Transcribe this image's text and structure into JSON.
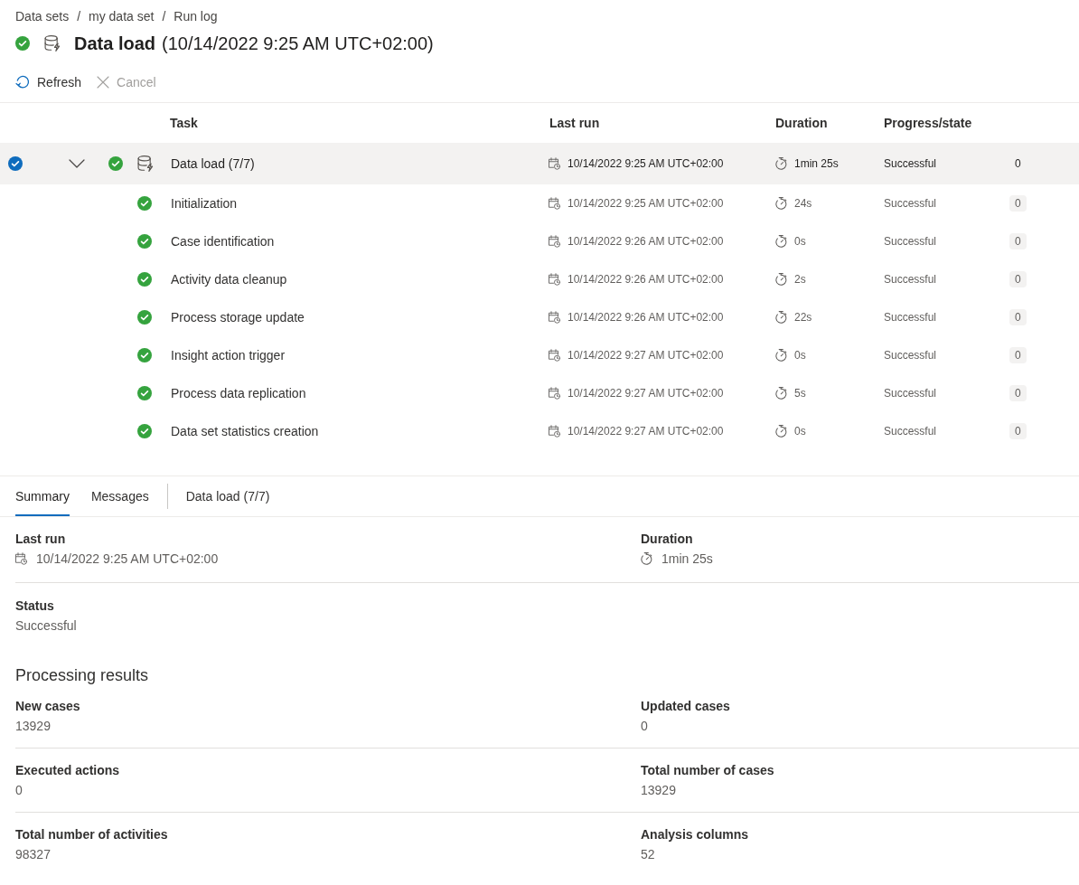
{
  "breadcrumb": [
    {
      "label": "Data sets",
      "separator": "/"
    },
    {
      "label": "my data set",
      "separator": "/"
    },
    {
      "label": "Run log"
    }
  ],
  "header": {
    "kind": "success",
    "title": "Data load",
    "subtitle": "(10/14/2022 9:25 AM UTC+02:00)"
  },
  "toolbar": [
    {
      "kind": "refresh",
      "label": "Refresh",
      "disabled": false
    },
    {
      "kind": "cancel",
      "label": "Cancel",
      "disabled": true
    }
  ],
  "table": {
    "columns": [
      "Task",
      "Last run",
      "Duration",
      "Progress/state"
    ],
    "rows": [
      {
        "selected": true,
        "expanded": true,
        "kind": "success",
        "task": "Data load (7/7)",
        "last_run": "10/14/2022 9:25 AM UTC+02:00",
        "duration": "1min 25s",
        "state": "Successful",
        "count": "0",
        "children": [
          {
            "selected": false,
            "kind": "success",
            "task": "Initialization",
            "last_run": "10/14/2022 9:25 AM UTC+02:00",
            "duration": "24s",
            "state": "Successful",
            "count": "0"
          },
          {
            "selected": false,
            "kind": "success",
            "task": "Case identification",
            "last_run": "10/14/2022 9:26 AM UTC+02:00",
            "duration": "0s",
            "state": "Successful",
            "count": "0"
          },
          {
            "selected": false,
            "kind": "success",
            "task": "Activity data cleanup",
            "last_run": "10/14/2022 9:26 AM UTC+02:00",
            "duration": "2s",
            "state": "Successful",
            "count": "0"
          },
          {
            "selected": false,
            "kind": "success",
            "task": "Process storage update",
            "last_run": "10/14/2022 9:26 AM UTC+02:00",
            "duration": "22s",
            "state": "Successful",
            "count": "0"
          },
          {
            "selected": false,
            "kind": "success",
            "task": "Insight action trigger",
            "last_run": "10/14/2022 9:27 AM UTC+02:00",
            "duration": "0s",
            "state": "Successful",
            "count": "0"
          },
          {
            "selected": false,
            "kind": "success",
            "task": "Process data replication",
            "last_run": "10/14/2022 9:27 AM UTC+02:00",
            "duration": "5s",
            "state": "Successful",
            "count": "0"
          },
          {
            "selected": false,
            "kind": "success",
            "task": "Data set statistics creation",
            "last_run": "10/14/2022 9:27 AM UTC+02:00",
            "duration": "0s",
            "state": "Successful",
            "count": "0"
          }
        ]
      }
    ]
  },
  "tab_groups": [
    [
      {
        "label": "Summary",
        "selected": true
      },
      {
        "label": "Messages",
        "selected": false
      }
    ],
    [
      {
        "label": "Data load (7/7)",
        "selected": false
      }
    ]
  ],
  "summary": {
    "rows": [
      [
        {
          "kind": "datetime",
          "label": "Last run",
          "value": "10/14/2022 9:25 AM UTC+02:00"
        },
        {
          "kind": "duration",
          "label": "Duration",
          "value": "1min 25s"
        }
      ],
      [
        {
          "kind": "text",
          "label": "Status",
          "value": "Successful"
        }
      ]
    ]
  },
  "processing_results": {
    "title": "Processing results",
    "rows": [
      [
        {
          "label": "New cases",
          "value": "13929"
        },
        {
          "label": "Updated cases",
          "value": "0"
        }
      ],
      [
        {
          "label": "Executed actions",
          "value": "0"
        },
        {
          "label": "Total number of cases",
          "value": "13929"
        }
      ],
      [
        {
          "label": "Total number of activities",
          "value": "98327"
        },
        {
          "label": "Analysis columns",
          "value": "52"
        }
      ]
    ]
  }
}
